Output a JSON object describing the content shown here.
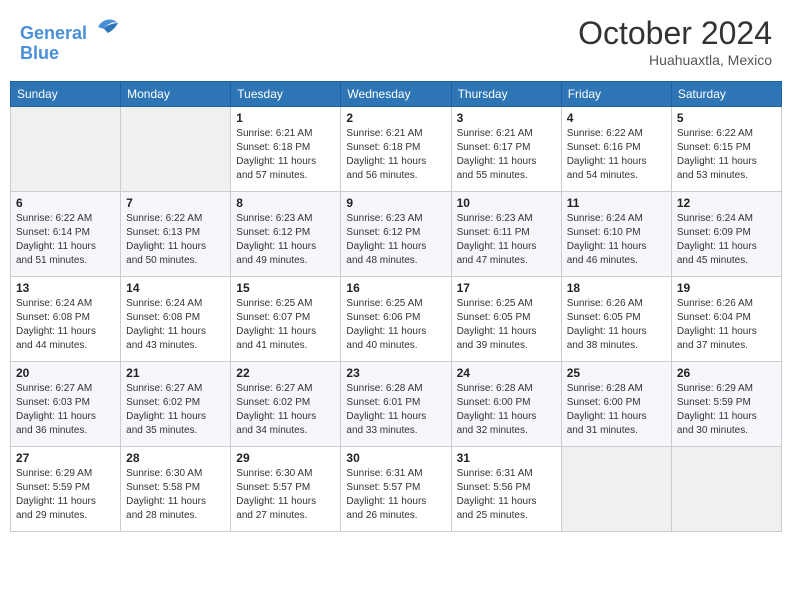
{
  "header": {
    "logo_line1": "General",
    "logo_line2": "Blue",
    "month": "October 2024",
    "location": "Huahuaxtla, Mexico"
  },
  "days_of_week": [
    "Sunday",
    "Monday",
    "Tuesday",
    "Wednesday",
    "Thursday",
    "Friday",
    "Saturday"
  ],
  "weeks": [
    [
      {
        "day": "",
        "info": ""
      },
      {
        "day": "",
        "info": ""
      },
      {
        "day": "1",
        "info": "Sunrise: 6:21 AM\nSunset: 6:18 PM\nDaylight: 11 hours and 57 minutes."
      },
      {
        "day": "2",
        "info": "Sunrise: 6:21 AM\nSunset: 6:18 PM\nDaylight: 11 hours and 56 minutes."
      },
      {
        "day": "3",
        "info": "Sunrise: 6:21 AM\nSunset: 6:17 PM\nDaylight: 11 hours and 55 minutes."
      },
      {
        "day": "4",
        "info": "Sunrise: 6:22 AM\nSunset: 6:16 PM\nDaylight: 11 hours and 54 minutes."
      },
      {
        "day": "5",
        "info": "Sunrise: 6:22 AM\nSunset: 6:15 PM\nDaylight: 11 hours and 53 minutes."
      }
    ],
    [
      {
        "day": "6",
        "info": "Sunrise: 6:22 AM\nSunset: 6:14 PM\nDaylight: 11 hours and 51 minutes."
      },
      {
        "day": "7",
        "info": "Sunrise: 6:22 AM\nSunset: 6:13 PM\nDaylight: 11 hours and 50 minutes."
      },
      {
        "day": "8",
        "info": "Sunrise: 6:23 AM\nSunset: 6:12 PM\nDaylight: 11 hours and 49 minutes."
      },
      {
        "day": "9",
        "info": "Sunrise: 6:23 AM\nSunset: 6:12 PM\nDaylight: 11 hours and 48 minutes."
      },
      {
        "day": "10",
        "info": "Sunrise: 6:23 AM\nSunset: 6:11 PM\nDaylight: 11 hours and 47 minutes."
      },
      {
        "day": "11",
        "info": "Sunrise: 6:24 AM\nSunset: 6:10 PM\nDaylight: 11 hours and 46 minutes."
      },
      {
        "day": "12",
        "info": "Sunrise: 6:24 AM\nSunset: 6:09 PM\nDaylight: 11 hours and 45 minutes."
      }
    ],
    [
      {
        "day": "13",
        "info": "Sunrise: 6:24 AM\nSunset: 6:08 PM\nDaylight: 11 hours and 44 minutes."
      },
      {
        "day": "14",
        "info": "Sunrise: 6:24 AM\nSunset: 6:08 PM\nDaylight: 11 hours and 43 minutes."
      },
      {
        "day": "15",
        "info": "Sunrise: 6:25 AM\nSunset: 6:07 PM\nDaylight: 11 hours and 41 minutes."
      },
      {
        "day": "16",
        "info": "Sunrise: 6:25 AM\nSunset: 6:06 PM\nDaylight: 11 hours and 40 minutes."
      },
      {
        "day": "17",
        "info": "Sunrise: 6:25 AM\nSunset: 6:05 PM\nDaylight: 11 hours and 39 minutes."
      },
      {
        "day": "18",
        "info": "Sunrise: 6:26 AM\nSunset: 6:05 PM\nDaylight: 11 hours and 38 minutes."
      },
      {
        "day": "19",
        "info": "Sunrise: 6:26 AM\nSunset: 6:04 PM\nDaylight: 11 hours and 37 minutes."
      }
    ],
    [
      {
        "day": "20",
        "info": "Sunrise: 6:27 AM\nSunset: 6:03 PM\nDaylight: 11 hours and 36 minutes."
      },
      {
        "day": "21",
        "info": "Sunrise: 6:27 AM\nSunset: 6:02 PM\nDaylight: 11 hours and 35 minutes."
      },
      {
        "day": "22",
        "info": "Sunrise: 6:27 AM\nSunset: 6:02 PM\nDaylight: 11 hours and 34 minutes."
      },
      {
        "day": "23",
        "info": "Sunrise: 6:28 AM\nSunset: 6:01 PM\nDaylight: 11 hours and 33 minutes."
      },
      {
        "day": "24",
        "info": "Sunrise: 6:28 AM\nSunset: 6:00 PM\nDaylight: 11 hours and 32 minutes."
      },
      {
        "day": "25",
        "info": "Sunrise: 6:28 AM\nSunset: 6:00 PM\nDaylight: 11 hours and 31 minutes."
      },
      {
        "day": "26",
        "info": "Sunrise: 6:29 AM\nSunset: 5:59 PM\nDaylight: 11 hours and 30 minutes."
      }
    ],
    [
      {
        "day": "27",
        "info": "Sunrise: 6:29 AM\nSunset: 5:59 PM\nDaylight: 11 hours and 29 minutes."
      },
      {
        "day": "28",
        "info": "Sunrise: 6:30 AM\nSunset: 5:58 PM\nDaylight: 11 hours and 28 minutes."
      },
      {
        "day": "29",
        "info": "Sunrise: 6:30 AM\nSunset: 5:57 PM\nDaylight: 11 hours and 27 minutes."
      },
      {
        "day": "30",
        "info": "Sunrise: 6:31 AM\nSunset: 5:57 PM\nDaylight: 11 hours and 26 minutes."
      },
      {
        "day": "31",
        "info": "Sunrise: 6:31 AM\nSunset: 5:56 PM\nDaylight: 11 hours and 25 minutes."
      },
      {
        "day": "",
        "info": ""
      },
      {
        "day": "",
        "info": ""
      }
    ]
  ]
}
